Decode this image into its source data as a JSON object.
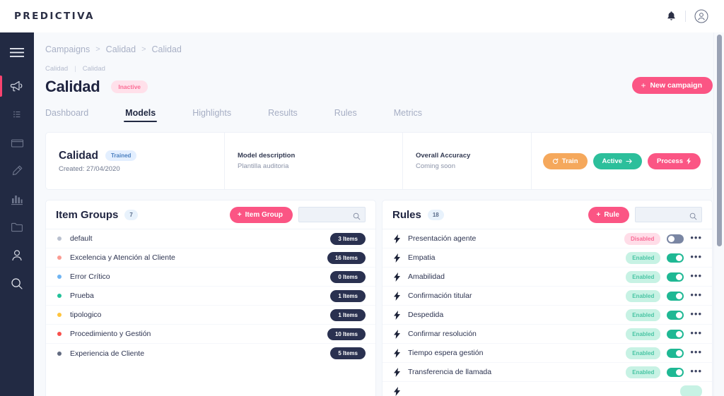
{
  "brand": {
    "logo": "PREDICTIVA"
  },
  "topbar": {
    "notifications_icon": "bell-icon",
    "account_icon": "user-circle-icon"
  },
  "sidebar": {
    "items": [
      {
        "icon": "hamburger-menu-icon",
        "name": "menu"
      },
      {
        "icon": "megaphone-icon",
        "name": "campaigns",
        "active": true
      },
      {
        "icon": "list-icon",
        "name": "lists"
      },
      {
        "icon": "archive-box-icon",
        "name": "archive"
      },
      {
        "icon": "highlighter-pen-icon",
        "name": "annotations"
      },
      {
        "icon": "bar-chart-icon",
        "name": "analytics"
      },
      {
        "icon": "folder-icon",
        "name": "folders"
      },
      {
        "icon": "user-icon",
        "name": "users"
      },
      {
        "icon": "search-icon",
        "name": "search"
      }
    ]
  },
  "breadcrumb": {
    "items": [
      "Campaigns",
      "Calidad",
      "Calidad"
    ],
    "separator": ">"
  },
  "subcrumb": {
    "left": "Calidad",
    "divider": "|",
    "right": "Calidad"
  },
  "header": {
    "title": "Calidad",
    "status_badge": "Inactive",
    "new_campaign_label": "New campaign",
    "new_campaign_plus": "+"
  },
  "tabs": [
    {
      "label": "Dashboard",
      "active": false
    },
    {
      "label": "Models",
      "active": true
    },
    {
      "label": "Highlights",
      "active": false
    },
    {
      "label": "Results",
      "active": false
    },
    {
      "label": "Rules",
      "active": false
    },
    {
      "label": "Metrics",
      "active": false
    }
  ],
  "model_card": {
    "name": "Calidad",
    "status_badge": "Trained",
    "created": "Created: 27/04/2020",
    "description_label": "Model description",
    "description_value": "Plantilla auditoria",
    "accuracy_label": "Overall Accuracy",
    "accuracy_value": "Coming soon",
    "actions": [
      {
        "label": "Train",
        "icon": "refresh-icon",
        "color": "#f5a85c"
      },
      {
        "label": "Active",
        "icon": "arrow-right-icon",
        "color": "#2cbf9b"
      },
      {
        "label": "Process",
        "icon": "lightning-icon",
        "color": "#fb5584"
      }
    ]
  },
  "item_groups_panel": {
    "title": "Item Groups",
    "count": "7",
    "add_label": "Item Group",
    "add_plus": "+",
    "search_placeholder": "",
    "search_value": "",
    "rows": [
      {
        "label": "default",
        "items": "3 Items",
        "color": "#b9c0cf"
      },
      {
        "label": "Excelencia y Atención al Cliente",
        "items": "16 Items",
        "color": "#fb9b92"
      },
      {
        "label": "Error Crítico",
        "items": "0 Items",
        "color": "#6fb4f2"
      },
      {
        "label": "Prueba",
        "items": "1 Items",
        "color": "#22c199"
      },
      {
        "label": "tipologico",
        "items": "1 Items",
        "color": "#ffc43d"
      },
      {
        "label": "Procedimiento y Gestión",
        "items": "10 Items",
        "color": "#f9504c"
      },
      {
        "label": "Experiencia de Cliente",
        "items": "5 Items",
        "color": "#626b80"
      }
    ]
  },
  "rules_panel": {
    "title": "Rules",
    "count": "18",
    "add_label": "Rule",
    "add_plus": "+",
    "search_placeholder": "",
    "search_value": "",
    "rows": [
      {
        "label": "Presentación agente",
        "state": "Disabled",
        "enabled": false
      },
      {
        "label": "Empatia",
        "state": "Enabled",
        "enabled": true
      },
      {
        "label": "Amabilidad",
        "state": "Enabled",
        "enabled": true
      },
      {
        "label": "Confirmación titular",
        "state": "Enabled",
        "enabled": true
      },
      {
        "label": "Despedida",
        "state": "Enabled",
        "enabled": true
      },
      {
        "label": "Confirmar resolución",
        "state": "Enabled",
        "enabled": true
      },
      {
        "label": "Tiempo espera gestión",
        "state": "Enabled",
        "enabled": true
      },
      {
        "label": "Transferencia de llamada",
        "state": "Enabled",
        "enabled": true
      }
    ],
    "row_menu_glyph": "•••"
  },
  "colors": {
    "accent_pink": "#fb5584",
    "sidebar_navy": "#222a43",
    "teal": "#1fb894",
    "orange": "#f5a85c",
    "page_bg": "#f7f9fc"
  }
}
